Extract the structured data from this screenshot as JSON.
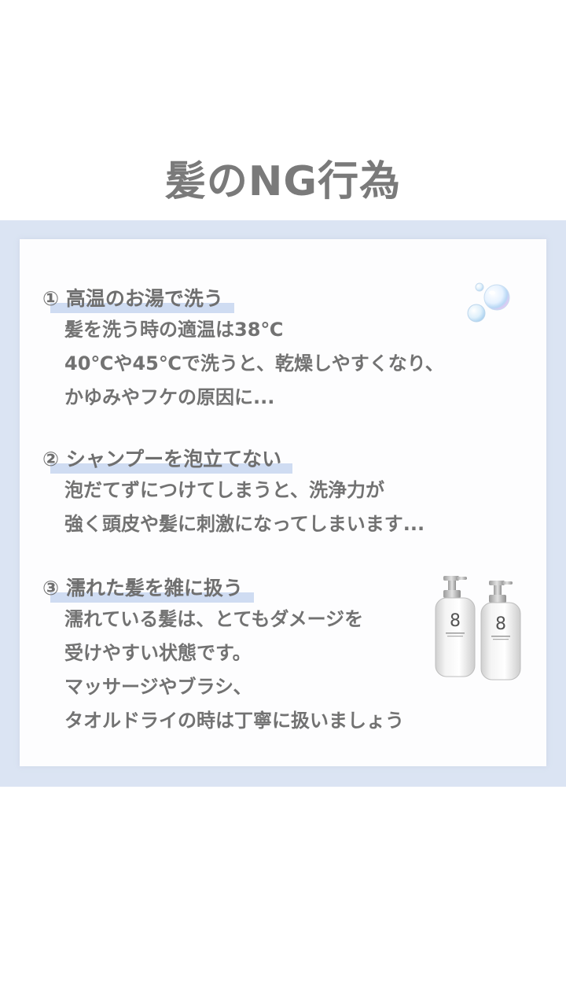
{
  "title": "髪のNG行為",
  "items": [
    {
      "heading": "①  高温のお湯で洗う",
      "lines": [
        "髪を洗う時の適温は38℃",
        "40℃や45℃で洗うと、乾燥しやすくなり、",
        "かゆみやフケの原因に..."
      ]
    },
    {
      "heading": "② シャンプーを泡立てない",
      "lines": [
        "泡だてずにつけてしまうと、洗浄力が",
        "強く頭皮や髪に刺激になってしまいます..."
      ]
    },
    {
      "heading": "③ 濡れた髪を雑に扱う",
      "lines": [
        "濡れている髪は、とてもダメージを",
        "受けやすい状態です。",
        "マッサージやブラシ、",
        "タオルドライの時は丁寧に扱いましょう"
      ]
    }
  ],
  "icons": {
    "bubbles": "soap-bubbles-icon",
    "bottles": "shampoo-bottles-image"
  },
  "colors": {
    "background_band": "#dbe4f3",
    "card": "#fdfdfe",
    "highlight": "#cfdcf2",
    "text": "#727272"
  }
}
